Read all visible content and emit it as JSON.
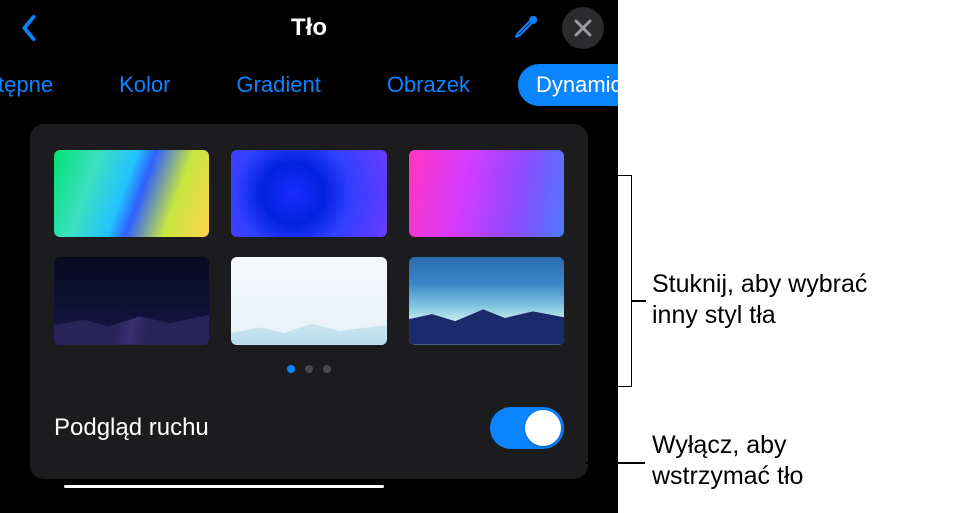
{
  "header": {
    "title": "Tło",
    "back_icon": "chevron-left",
    "eyedropper_icon": "eyedropper",
    "close_icon": "close"
  },
  "tabs": [
    {
      "label": "tępne",
      "active": false
    },
    {
      "label": "Kolor",
      "active": false
    },
    {
      "label": "Gradient",
      "active": false
    },
    {
      "label": "Obrazek",
      "active": false
    },
    {
      "label": "Dynamiczne",
      "active": true
    }
  ],
  "thumbnails": [
    {
      "name": "gradient-rainbow"
    },
    {
      "name": "gradient-blue"
    },
    {
      "name": "gradient-magenta"
    },
    {
      "name": "landscape-night"
    },
    {
      "name": "landscape-white"
    },
    {
      "name": "landscape-blue-mountains"
    }
  ],
  "pager": {
    "count": 3,
    "active_index": 0
  },
  "motion_toggle": {
    "label": "Podgląd ruchu",
    "on": true
  },
  "annotations": {
    "thumb_hint_line1": "Stuknij, aby wybrać",
    "thumb_hint_line2": "inny styl tła",
    "toggle_hint_line1": "Wyłącz, aby",
    "toggle_hint_line2": "wstrzymać tło"
  }
}
